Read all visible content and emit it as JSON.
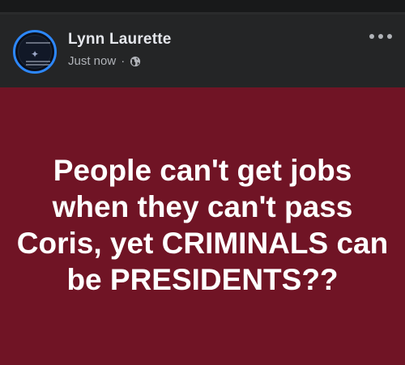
{
  "post": {
    "author": "Lynn Laurette",
    "timestamp": "Just now",
    "separator": "·",
    "audience_icon": "globe-icon",
    "more_icon": "more-options-icon",
    "background_color": "#701425",
    "text": "People can't get jobs when they can't pass Coris, yet CRIMINALS can be PRESIDENTS??"
  },
  "colors": {
    "avatar_ring": "#2d88ff",
    "header_bg": "#242526",
    "text_primary": "#e4e6eb",
    "text_secondary": "#b0b3b8"
  }
}
